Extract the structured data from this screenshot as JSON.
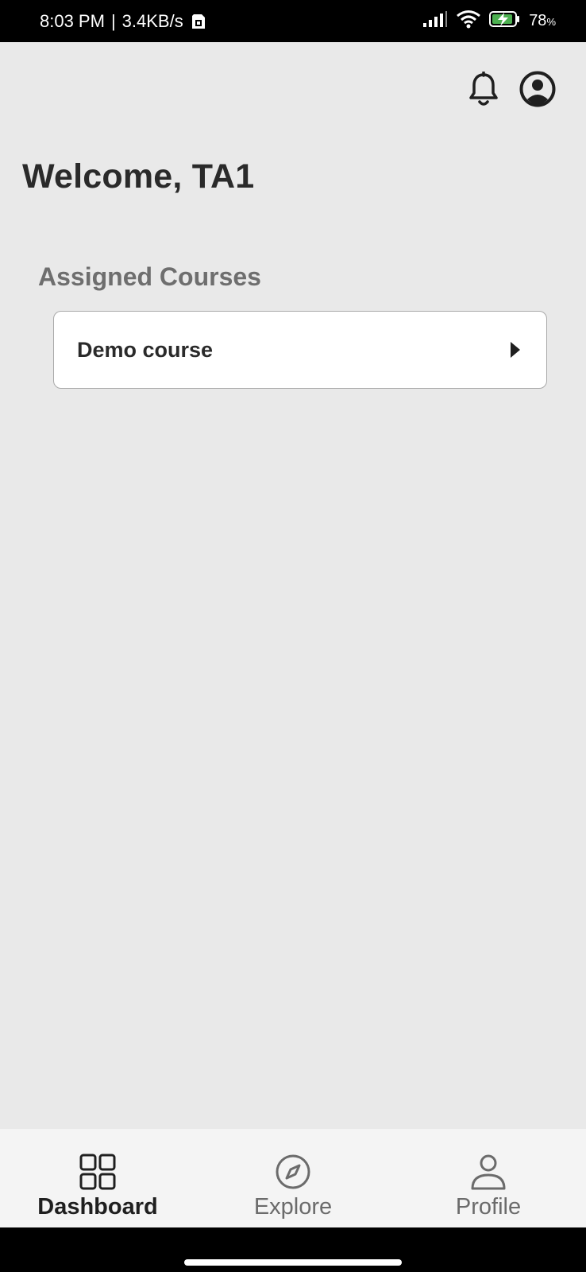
{
  "status_bar": {
    "time": "8:03 PM",
    "separator": "|",
    "network_speed": "3.4KB/s",
    "battery_percent": "78",
    "battery_unit": "%",
    "icons": [
      "sd-card-icon",
      "signal-icon",
      "wifi-icon",
      "battery-charging-icon"
    ]
  },
  "header": {
    "icons": [
      "bell-icon",
      "account-icon"
    ]
  },
  "main": {
    "welcome_text": "Welcome, TA1",
    "section_title": "Assigned Courses",
    "courses": [
      {
        "name": "Demo course"
      }
    ]
  },
  "bottom_nav": {
    "items": [
      {
        "label": "Dashboard",
        "icon": "grid-icon",
        "active": true
      },
      {
        "label": "Explore",
        "icon": "compass-icon",
        "active": false
      },
      {
        "label": "Profile",
        "icon": "person-icon",
        "active": false
      }
    ]
  },
  "colors": {
    "background": "#e9e9e9",
    "card": "#ffffff",
    "status_bar": "#000000",
    "bottom_nav": "#f4f4f4",
    "battery_bolt": "#4caf50"
  }
}
